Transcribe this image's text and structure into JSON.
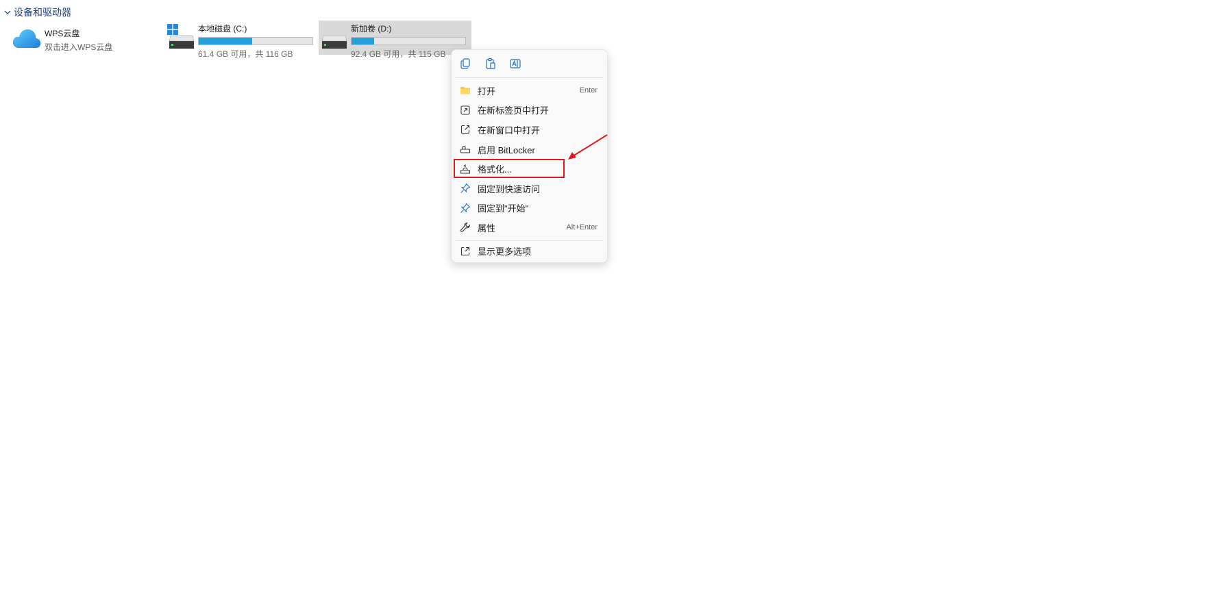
{
  "section": {
    "title": "设备和驱动器"
  },
  "wps": {
    "title": "WPS云盘",
    "subtitle": "双击进入WPS云盘"
  },
  "drives": [
    {
      "name": "本地磁盘 (C:)",
      "free_text": "61.4 GB 可用，共 116 GB",
      "used_fraction": 0.47
    },
    {
      "name": "新加卷 (D:)",
      "free_text": "92.4 GB 可用，共 115 GB",
      "used_fraction": 0.2
    }
  ],
  "menu": {
    "top_icons": [
      "copy-icon",
      "paste-icon",
      "rename-icon"
    ],
    "items": [
      {
        "label": "打开",
        "shortcut": "Enter",
        "icon": "folder-icon"
      },
      {
        "label": "在新标签页中打开",
        "shortcut": "",
        "icon": "open-tab-icon"
      },
      {
        "label": "在新窗口中打开",
        "shortcut": "",
        "icon": "open-window-icon"
      },
      {
        "label": "启用 BitLocker",
        "shortcut": "",
        "icon": "key-icon"
      },
      {
        "label": "格式化...",
        "shortcut": "",
        "icon": "format-icon"
      },
      {
        "label": "固定到快速访问",
        "shortcut": "",
        "icon": "pin-icon"
      },
      {
        "label": "固定到\"开始\"",
        "shortcut": "",
        "icon": "pin-icon"
      },
      {
        "label": "属性",
        "shortcut": "Alt+Enter",
        "icon": "wrench-icon"
      }
    ],
    "more": {
      "label": "显示更多选项",
      "icon": "more-options-icon"
    }
  },
  "colors": {
    "accent": "#26a0da",
    "highlight": "#e0191f",
    "selected_drive_bg": "#d9d9d9"
  }
}
